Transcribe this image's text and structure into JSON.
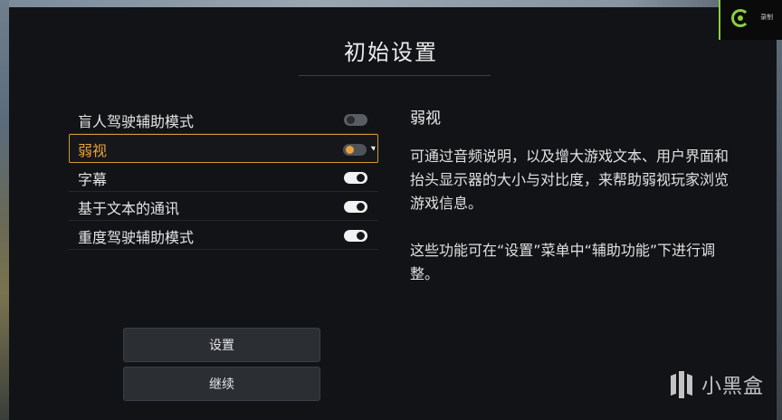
{
  "title": "初始设置",
  "options": [
    {
      "label": "盲人驾驶辅助模式",
      "state": "off",
      "selected": false
    },
    {
      "label": "弱视",
      "state": "selected-off",
      "selected": true
    },
    {
      "label": "字幕",
      "state": "on",
      "selected": false
    },
    {
      "label": "基于文本的通讯",
      "state": "on",
      "selected": false
    },
    {
      "label": "重度驾驶辅助模式",
      "state": "on",
      "selected": false
    }
  ],
  "detail": {
    "title": "弱视",
    "paragraph1": "可通过音频说明，以及增大游戏文本、用户界面和抬头显示器的大小与对比度，来帮助弱视玩家浏览游戏信息。",
    "paragraph2": "这些功能可在“设置”菜单中“辅助功能”下进行调整。"
  },
  "buttons": {
    "settings_label": "设置",
    "continue_label": "继续"
  },
  "recording_badge": {
    "icon": "record-icon",
    "text": "录制"
  },
  "watermark": {
    "icon": "heybox-logo-icon",
    "text": "小黑盒"
  },
  "colors": {
    "accent": "#e8a33c",
    "toggle_on": "#f2f2f2",
    "recording": "#8bcf3e"
  }
}
